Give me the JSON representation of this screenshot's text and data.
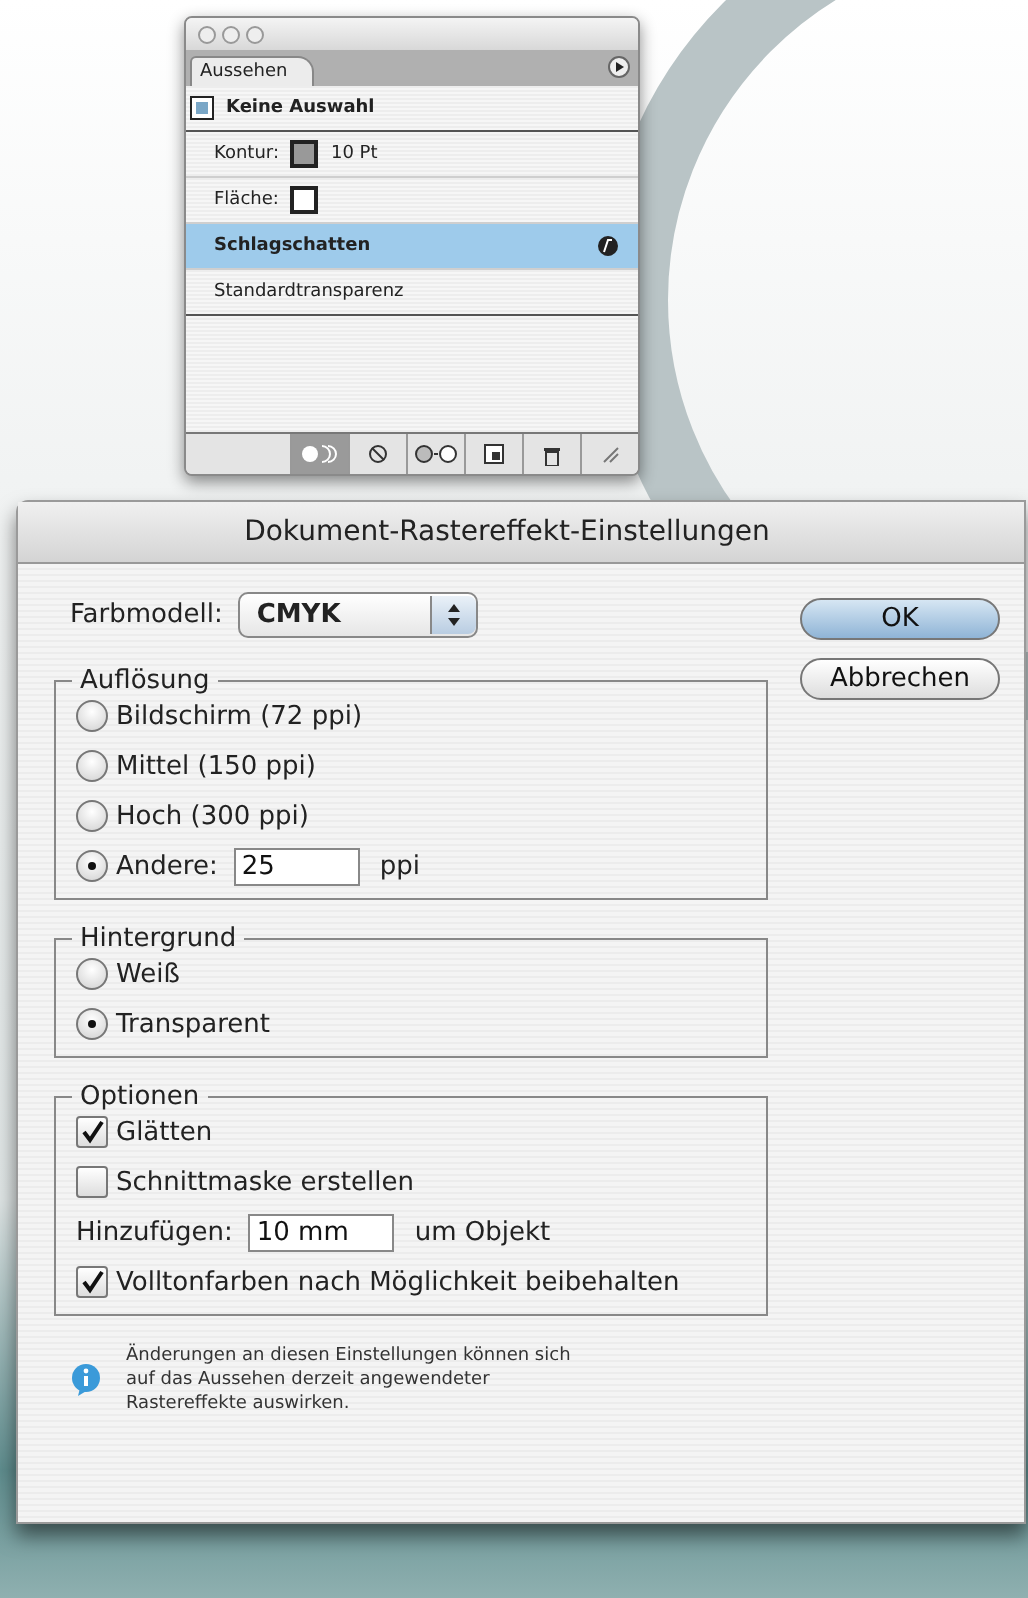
{
  "panel": {
    "tab": "Aussehen",
    "items": [
      {
        "kind": "object",
        "label": "Keine Auswahl",
        "selected": false
      },
      {
        "kind": "stroke",
        "label": "Kontur:",
        "value": "10 Pt",
        "selected": false
      },
      {
        "kind": "fill",
        "label": "Fläche:",
        "selected": false
      },
      {
        "kind": "effect",
        "label": "Schlagschatten",
        "selected": true
      },
      {
        "kind": "plain",
        "label": "Standardtransparenz",
        "selected": false
      }
    ]
  },
  "dialog": {
    "title": "Dokument-Rastereffekt-Einstellungen",
    "color_model": {
      "label": "Farbmodell:",
      "value": "CMYK"
    },
    "buttons": [
      {
        "label": "OK",
        "default": true
      },
      {
        "label": "Abbrechen",
        "default": false
      }
    ],
    "resolution": {
      "legend": "Auflösung",
      "options": [
        {
          "label": "Bildschirm (72 ppi)",
          "selected": false
        },
        {
          "label": "Mittel (150 ppi)",
          "selected": false
        },
        {
          "label": "Hoch (300 ppi)",
          "selected": false
        },
        {
          "label": "Andere:",
          "selected": true,
          "value": "25",
          "unit": "ppi"
        }
      ]
    },
    "background": {
      "legend": "Hintergrund",
      "options": [
        {
          "label": "Weiß",
          "selected": false
        },
        {
          "label": "Transparent",
          "selected": true
        }
      ]
    },
    "options": {
      "legend": "Optionen",
      "items": [
        {
          "kind": "checkbox",
          "label": "Glätten",
          "checked": true
        },
        {
          "kind": "checkbox",
          "label": "Schnittmaske erstellen",
          "checked": false
        },
        {
          "kind": "field",
          "label": "Hinzufügen:",
          "value": "10 mm",
          "unit": "um Objekt"
        },
        {
          "kind": "checkbox",
          "label": "Volltonfarben nach Möglichkeit beibehalten",
          "checked": true
        }
      ]
    },
    "note": "Änderungen an diesen Einstellungen können sich\nauf das Aussehen derzeit angewendeter\nRastereffekte auswirken."
  }
}
